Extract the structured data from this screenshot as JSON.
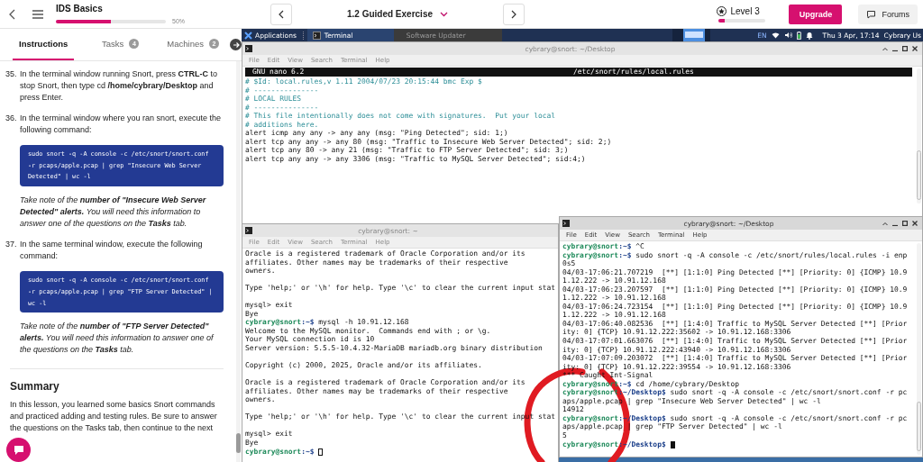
{
  "header": {
    "title": "IDS Basics",
    "progress": {
      "level": 0.5,
      "reading": "50%"
    },
    "exercise": "1.2 Guided Exercise",
    "level_badge": {
      "label": "Level 3",
      "level": 0.12
    },
    "buttons": [
      {
        "label": "Upgrade",
        "kind": "primary"
      },
      {
        "label": "Forums",
        "kind": "secondary"
      }
    ]
  },
  "panel_tabs": [
    {
      "label": "Instructions",
      "selected": true
    },
    {
      "label": "Tasks",
      "badge": "4",
      "selected": false
    },
    {
      "label": "Machines",
      "badge": "2",
      "selected": false
    }
  ],
  "instructions": [
    {
      "number": "35.",
      "text": "In the terminal window running Snort, press **CTRL-C** to stop Snort, then type cd **/home/cybrary/Desktop** and press Enter."
    },
    {
      "number": "36.",
      "text": "In the terminal window where you ran snort, execute the following command:",
      "code": "sudo snort -q -A console -c /etc/snort/snort.conf -r pcaps/apple.pcap | grep \"Insecure Web Server Detected\" | wc -l",
      "note": "Take note of the **number of \"Insecure Web Server Detected\" alerts.** You will need this information to answer one of the questions on the **Tasks** tab."
    },
    {
      "number": "37.",
      "text": "In the same terminal window, execute the following command:",
      "code": "sudo snort -q -A console -c /etc/snort/snort.conf -r pcaps/apple.pcap | grep \"FTP Server Detected\" | wc -l",
      "note": "Take note of the **number of \"FTP Server Detected\" alerts.** You will need this information to answer one of the questions on the **Tasks** tab."
    }
  ],
  "summary": {
    "heading": "Summary",
    "text": "In this lesson, you learned some basics Snort commands and practiced adding and testing rules. Be sure to answer the questions on the Tasks tab, then continue to the next"
  },
  "taskbar": {
    "items": [
      {
        "label": "Applications",
        "kind": "menu"
      },
      {
        "label": "Terminal",
        "kind": "window",
        "selected": true
      },
      {
        "label": "Software Updater",
        "kind": "window",
        "selected": false
      }
    ],
    "keyboard": "EN",
    "clock": "Thu 3 Apr, 17:14",
    "user": "Cybrary Us"
  },
  "windows": [
    {
      "kind": "editor",
      "title": "cybrary@snort: ~/Desktop",
      "active": false,
      "controls": true,
      "menu": [
        "File",
        "Edit",
        "View",
        "Search",
        "Terminal",
        "Help"
      ],
      "editor_header": {
        "version": "GNU nano 6.2",
        "file": "/etc/snort/rules/local.rules"
      },
      "lines": [
        {
          "kind": "comment",
          "text": "# $Id: local.rules,v 1.11 2004/07/23 20:15:44 bmc Exp $"
        },
        {
          "kind": "comment",
          "text": "# ---------------"
        },
        {
          "kind": "comment",
          "text": "# LOCAL RULES"
        },
        {
          "kind": "comment",
          "text": "# ---------------"
        },
        {
          "kind": "comment",
          "text": "# This file intentionally does not come with signatures.  Put your local"
        },
        {
          "kind": "comment",
          "text": "# additions here."
        },
        {
          "kind": "output",
          "text": "alert icmp any any -> any any (msg: \"Ping Detected\"; sid: 1;)"
        },
        {
          "kind": "output",
          "text": "alert tcp any any -> any 80 (msg: \"Traffic to Insecure Web Server Detected\"; sid: 2;)"
        },
        {
          "kind": "output",
          "text": "alert tcp any 80 -> any 21 (msg: \"Traffic to FTP Server Detected\"; sid: 3;)"
        },
        {
          "kind": "output",
          "text": "alert tcp any any -> any 3306 (msg: \"Traffic to MySQL Server Detected\"; sid:4;)"
        }
      ]
    },
    {
      "kind": "terminal",
      "title": "cybrary@snort: ~",
      "active": false,
      "controls": false,
      "menu": [
        "File",
        "Edit",
        "View",
        "Search",
        "Terminal",
        "Help"
      ],
      "lines": [
        {
          "kind": "output",
          "text": "Oracle is a registered trademark of Oracle Corporation and/or its"
        },
        {
          "kind": "output",
          "text": "affiliates. Other names may be trademarks of their respective"
        },
        {
          "kind": "output",
          "text": "owners."
        },
        {
          "kind": "blank"
        },
        {
          "kind": "output",
          "text": "Type 'help;' or '\\h' for help. Type '\\c' to clear the current input stat"
        },
        {
          "kind": "blank"
        },
        {
          "kind": "output",
          "text": "mysql> exit"
        },
        {
          "kind": "output",
          "text": "Bye"
        },
        {
          "kind": "prompt",
          "user": "cybrary@snort",
          "path": ":~$",
          "text": " mysql -h 10.91.12.168"
        },
        {
          "kind": "output",
          "text": "Welcome to the MySQL monitor.  Commands end with ; or \\g."
        },
        {
          "kind": "output",
          "text": "Your MySQL connection id is 10"
        },
        {
          "kind": "output",
          "text": "Server version: 5.5.5-10.4.32-MariaDB mariadb.org binary distribution"
        },
        {
          "kind": "blank"
        },
        {
          "kind": "output",
          "text": "Copyright (c) 2000, 2025, Oracle and/or its affiliates."
        },
        {
          "kind": "blank"
        },
        {
          "kind": "output",
          "text": "Oracle is a registered trademark of Oracle Corporation and/or its"
        },
        {
          "kind": "output",
          "text": "affiliates. Other names may be trademarks of their respective"
        },
        {
          "kind": "output",
          "text": "owners."
        },
        {
          "kind": "blank"
        },
        {
          "kind": "output",
          "text": "Type 'help;' or '\\h' for help. Type '\\c' to clear the current input stat"
        },
        {
          "kind": "blank"
        },
        {
          "kind": "output",
          "text": "mysql> exit"
        },
        {
          "kind": "output",
          "text": "Bye"
        },
        {
          "kind": "prompt",
          "user": "cybrary@snort",
          "path": ":~$",
          "cursor": true
        }
      ]
    },
    {
      "kind": "terminal",
      "title": "cybrary@snort: ~/Desktop",
      "active": true,
      "controls": true,
      "menu": [
        "File",
        "Edit",
        "View",
        "Search",
        "Terminal",
        "Help"
      ],
      "lines": [
        {
          "kind": "prompt",
          "user": "cybrary@snort",
          "path": ":~$",
          "text": " ^C"
        },
        {
          "kind": "prompt",
          "user": "cybrary@snort",
          "path": ":~$",
          "text": " sudo snort -q -A console -c /etc/snort/rules/local.rules -i enp"
        },
        {
          "kind": "output",
          "text": "0s5"
        },
        {
          "kind": "output",
          "text": "04/03-17:06:21.707219  [**] [1:1:0] Ping Detected [**] [Priority: 0] {ICMP} 10.9"
        },
        {
          "kind": "output",
          "text": "1.12.222 -> 10.91.12.168"
        },
        {
          "kind": "output",
          "text": "04/03-17:06:23.207597  [**] [1:1:0] Ping Detected [**] [Priority: 0] {ICMP} 10.9"
        },
        {
          "kind": "output",
          "text": "1.12.222 -> 10.91.12.168"
        },
        {
          "kind": "output",
          "text": "04/03-17:06:24.723154  [**] [1:1:0] Ping Detected [**] [Priority: 0] {ICMP} 10.9"
        },
        {
          "kind": "output",
          "text": "1.12.222 -> 10.91.12.168"
        },
        {
          "kind": "output",
          "text": "04/03-17:06:40.082536  [**] [1:4:0] Traffic to MySQL Server Detected [**] [Prior"
        },
        {
          "kind": "output",
          "text": "ity: 0] {TCP} 10.91.12.222:35602 -> 10.91.12.168:3306"
        },
        {
          "kind": "output",
          "text": "04/03-17:07:01.663076  [**] [1:4:0] Traffic to MySQL Server Detected [**] [Prior"
        },
        {
          "kind": "output",
          "text": "ity: 0] {TCP} 10.91.12.222:43940 -> 10.91.12.168:3306"
        },
        {
          "kind": "output",
          "text": "04/03-17:07:09.203072  [**] [1:4:0] Traffic to MySQL Server Detected [**] [Prior"
        },
        {
          "kind": "output",
          "text": "ity: 0] {TCP} 10.91.12.222:39554 -> 10.91.12.168:3306"
        },
        {
          "kind": "output",
          "text": "*** Caught Int-Signal"
        },
        {
          "kind": "prompt",
          "user": "cybrary@snort",
          "path": ":~$",
          "text": " cd /home/cybrary/Desktop"
        },
        {
          "kind": "prompt",
          "user": "cybrary@snort",
          "path": ":~/Desktop$",
          "text": " sudo snort -q -A console -c /etc/snort/snort.conf -r pc"
        },
        {
          "kind": "output",
          "text": "aps/apple.pcap | grep \"Insecure Web Server Detected\" | wc -l"
        },
        {
          "kind": "output",
          "text": "14912"
        },
        {
          "kind": "prompt",
          "user": "cybrary@snort",
          "path": ":~/Desktop$",
          "text": " sudo snort -q -A console -c /etc/snort/snort.conf -r pc"
        },
        {
          "kind": "output",
          "text": "aps/apple.pcap | grep \"FTP Server Detected\" | wc -l"
        },
        {
          "kind": "output",
          "text": "5"
        },
        {
          "kind": "prompt",
          "user": "cybrary@snort",
          "path": ":~/Desktop$",
          "cursor": true
        }
      ]
    }
  ]
}
